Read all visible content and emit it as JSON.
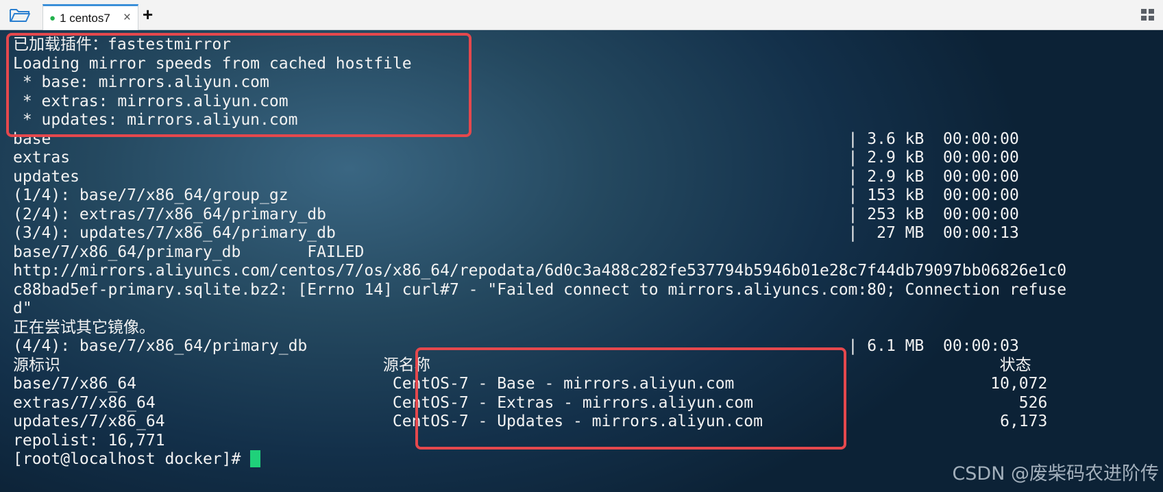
{
  "tabbar": {
    "tab_dot": "●",
    "tab_label": "1 centos7",
    "tab_close": "×",
    "new_tab": "+"
  },
  "terminal": {
    "lines": [
      "已加载插件：fastestmirror",
      "Loading mirror speeds from cached hostfile",
      " * base: mirrors.aliyun.com",
      " * extras: mirrors.aliyun.com",
      " * updates: mirrors.aliyun.com",
      "base                                                                                    | 3.6 kB  00:00:00",
      "extras                                                                                  | 2.9 kB  00:00:00",
      "updates                                                                                 | 2.9 kB  00:00:00",
      "(1/4): base/7/x86_64/group_gz                                                           | 153 kB  00:00:00",
      "(2/4): extras/7/x86_64/primary_db                                                       | 253 kB  00:00:00",
      "(3/4): updates/7/x86_64/primary_db                                                      |  27 MB  00:00:13",
      "base/7/x86_64/primary_db       FAILED",
      "http://mirrors.aliyuncs.com/centos/7/os/x86_64/repodata/6d0c3a488c282fe537794b5946b01e28c7f44db79097bb06826e1c0",
      "c88bad5ef-primary.sqlite.bz2: [Errno 14] curl#7 - \"Failed connect to mirrors.aliyuncs.com:80; Connection refuse",
      "d\"",
      "正在尝试其它镜像。",
      "(4/4): base/7/x86_64/primary_db                                                         | 6.1 MB  00:00:03",
      "源标识                                  源名称                                                            状态",
      "base/7/x86_64                           CentOS-7 - Base - mirrors.aliyun.com                           10,072",
      "extras/7/x86_64                         CentOS-7 - Extras - mirrors.aliyun.com                            526",
      "updates/7/x86_64                        CentOS-7 - Updates - mirrors.aliyun.com                         6,173",
      "repolist: 16,771"
    ],
    "prompt": "[root@localhost docker]# "
  },
  "watermark": "CSDN @废柴码农进阶传",
  "colors": {
    "tab_accent": "#3a8fd8",
    "status_dot": "#22b14c",
    "highlight_box": "#e5484d",
    "cursor": "#1fd17a",
    "terminal_text": "#f2f2f2"
  },
  "icons": {
    "open_folder": "folder-open-icon",
    "layout": "grid-layout-icon"
  }
}
